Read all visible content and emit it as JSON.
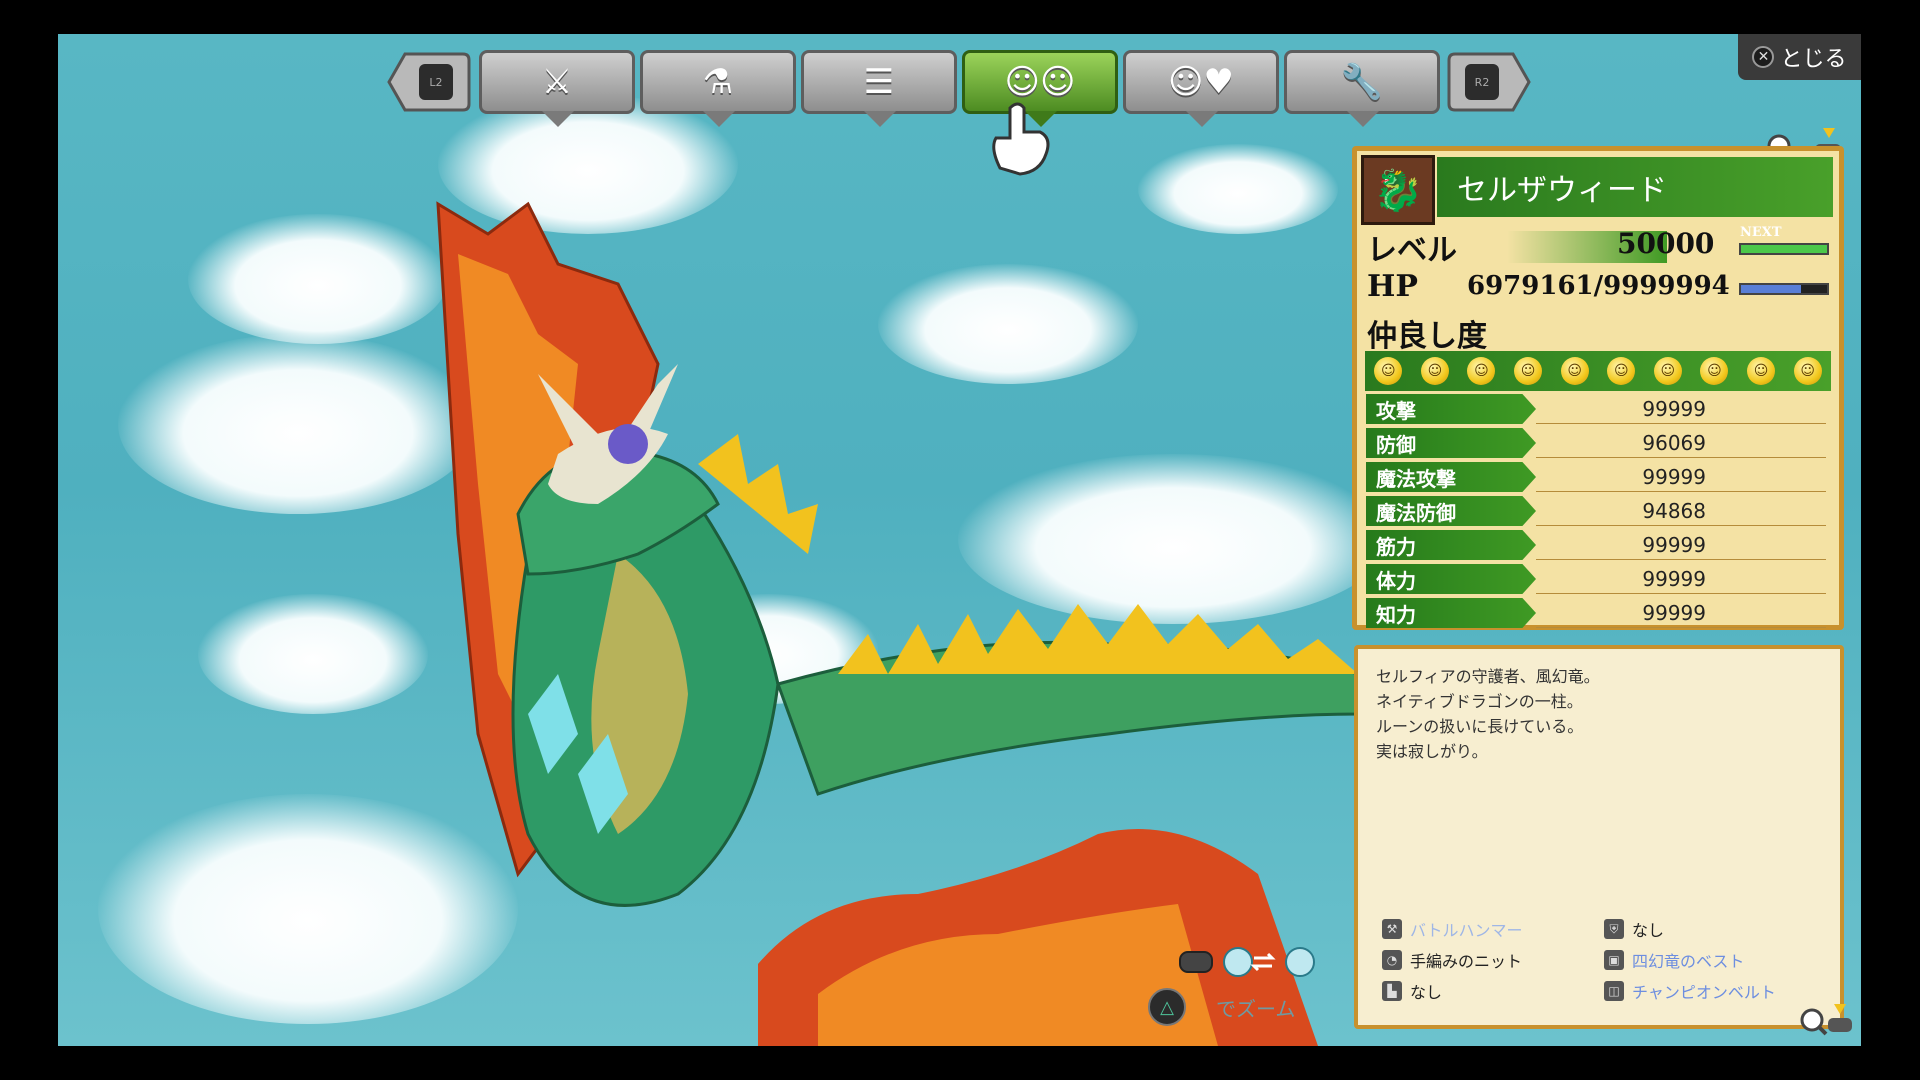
{
  "close": {
    "label": "とじる",
    "icon": "x"
  },
  "tabs": [
    {
      "id": "l2",
      "label": "L2"
    },
    {
      "id": "equip",
      "icon": "sword-shield"
    },
    {
      "id": "craft",
      "icon": "flask-hammer"
    },
    {
      "id": "docs",
      "icon": "document"
    },
    {
      "id": "party",
      "icon": "party-faces",
      "active": true
    },
    {
      "id": "affinity",
      "icon": "smile-heart"
    },
    {
      "id": "settings",
      "icon": "wrench"
    },
    {
      "id": "r2",
      "label": "R2"
    }
  ],
  "character": {
    "name": "セルザウィード",
    "level_label": "レベル",
    "level": "50000",
    "next_label": "NEXT",
    "next_fill": 1.0,
    "hp_label": "HP",
    "hp": "6979161/9999994",
    "hp_fill": 0.698,
    "affinity_label": "仲良し度",
    "affinity_count": 10
  },
  "stats": [
    {
      "label": "攻撃",
      "value": "99999"
    },
    {
      "label": "防御",
      "value": "96069"
    },
    {
      "label": "魔法攻撃",
      "value": "99999"
    },
    {
      "label": "魔法防御",
      "value": "94868"
    },
    {
      "label": "筋力",
      "value": "99999"
    },
    {
      "label": "体力",
      "value": "99999"
    },
    {
      "label": "知力",
      "value": "99999"
    }
  ],
  "description": [
    "セルフィアの守護者、風幻竜。",
    "ネイティブドラゴンの一柱。",
    "ルーンの扱いに長けている。",
    "実は寂しがり。"
  ],
  "equipment": [
    {
      "name": "バトルハンマー",
      "style": "faded"
    },
    {
      "name": "なし",
      "style": "dark"
    },
    {
      "name": "手編みのニット",
      "style": "dark"
    },
    {
      "name": "四幻竜のベスト",
      "style": "blue"
    },
    {
      "name": "なし",
      "style": "dark"
    },
    {
      "name": "チャンピオンベルト",
      "style": "blue"
    }
  ],
  "controls": {
    "zoom_label": "でズーム"
  },
  "colors": {
    "accent_green": "#3f9a24",
    "panel_bg": "#f4e2a4",
    "panel_border": "#c8912d",
    "hp_bar": "#5a7fd6",
    "next_bar": "#4cc84a"
  }
}
